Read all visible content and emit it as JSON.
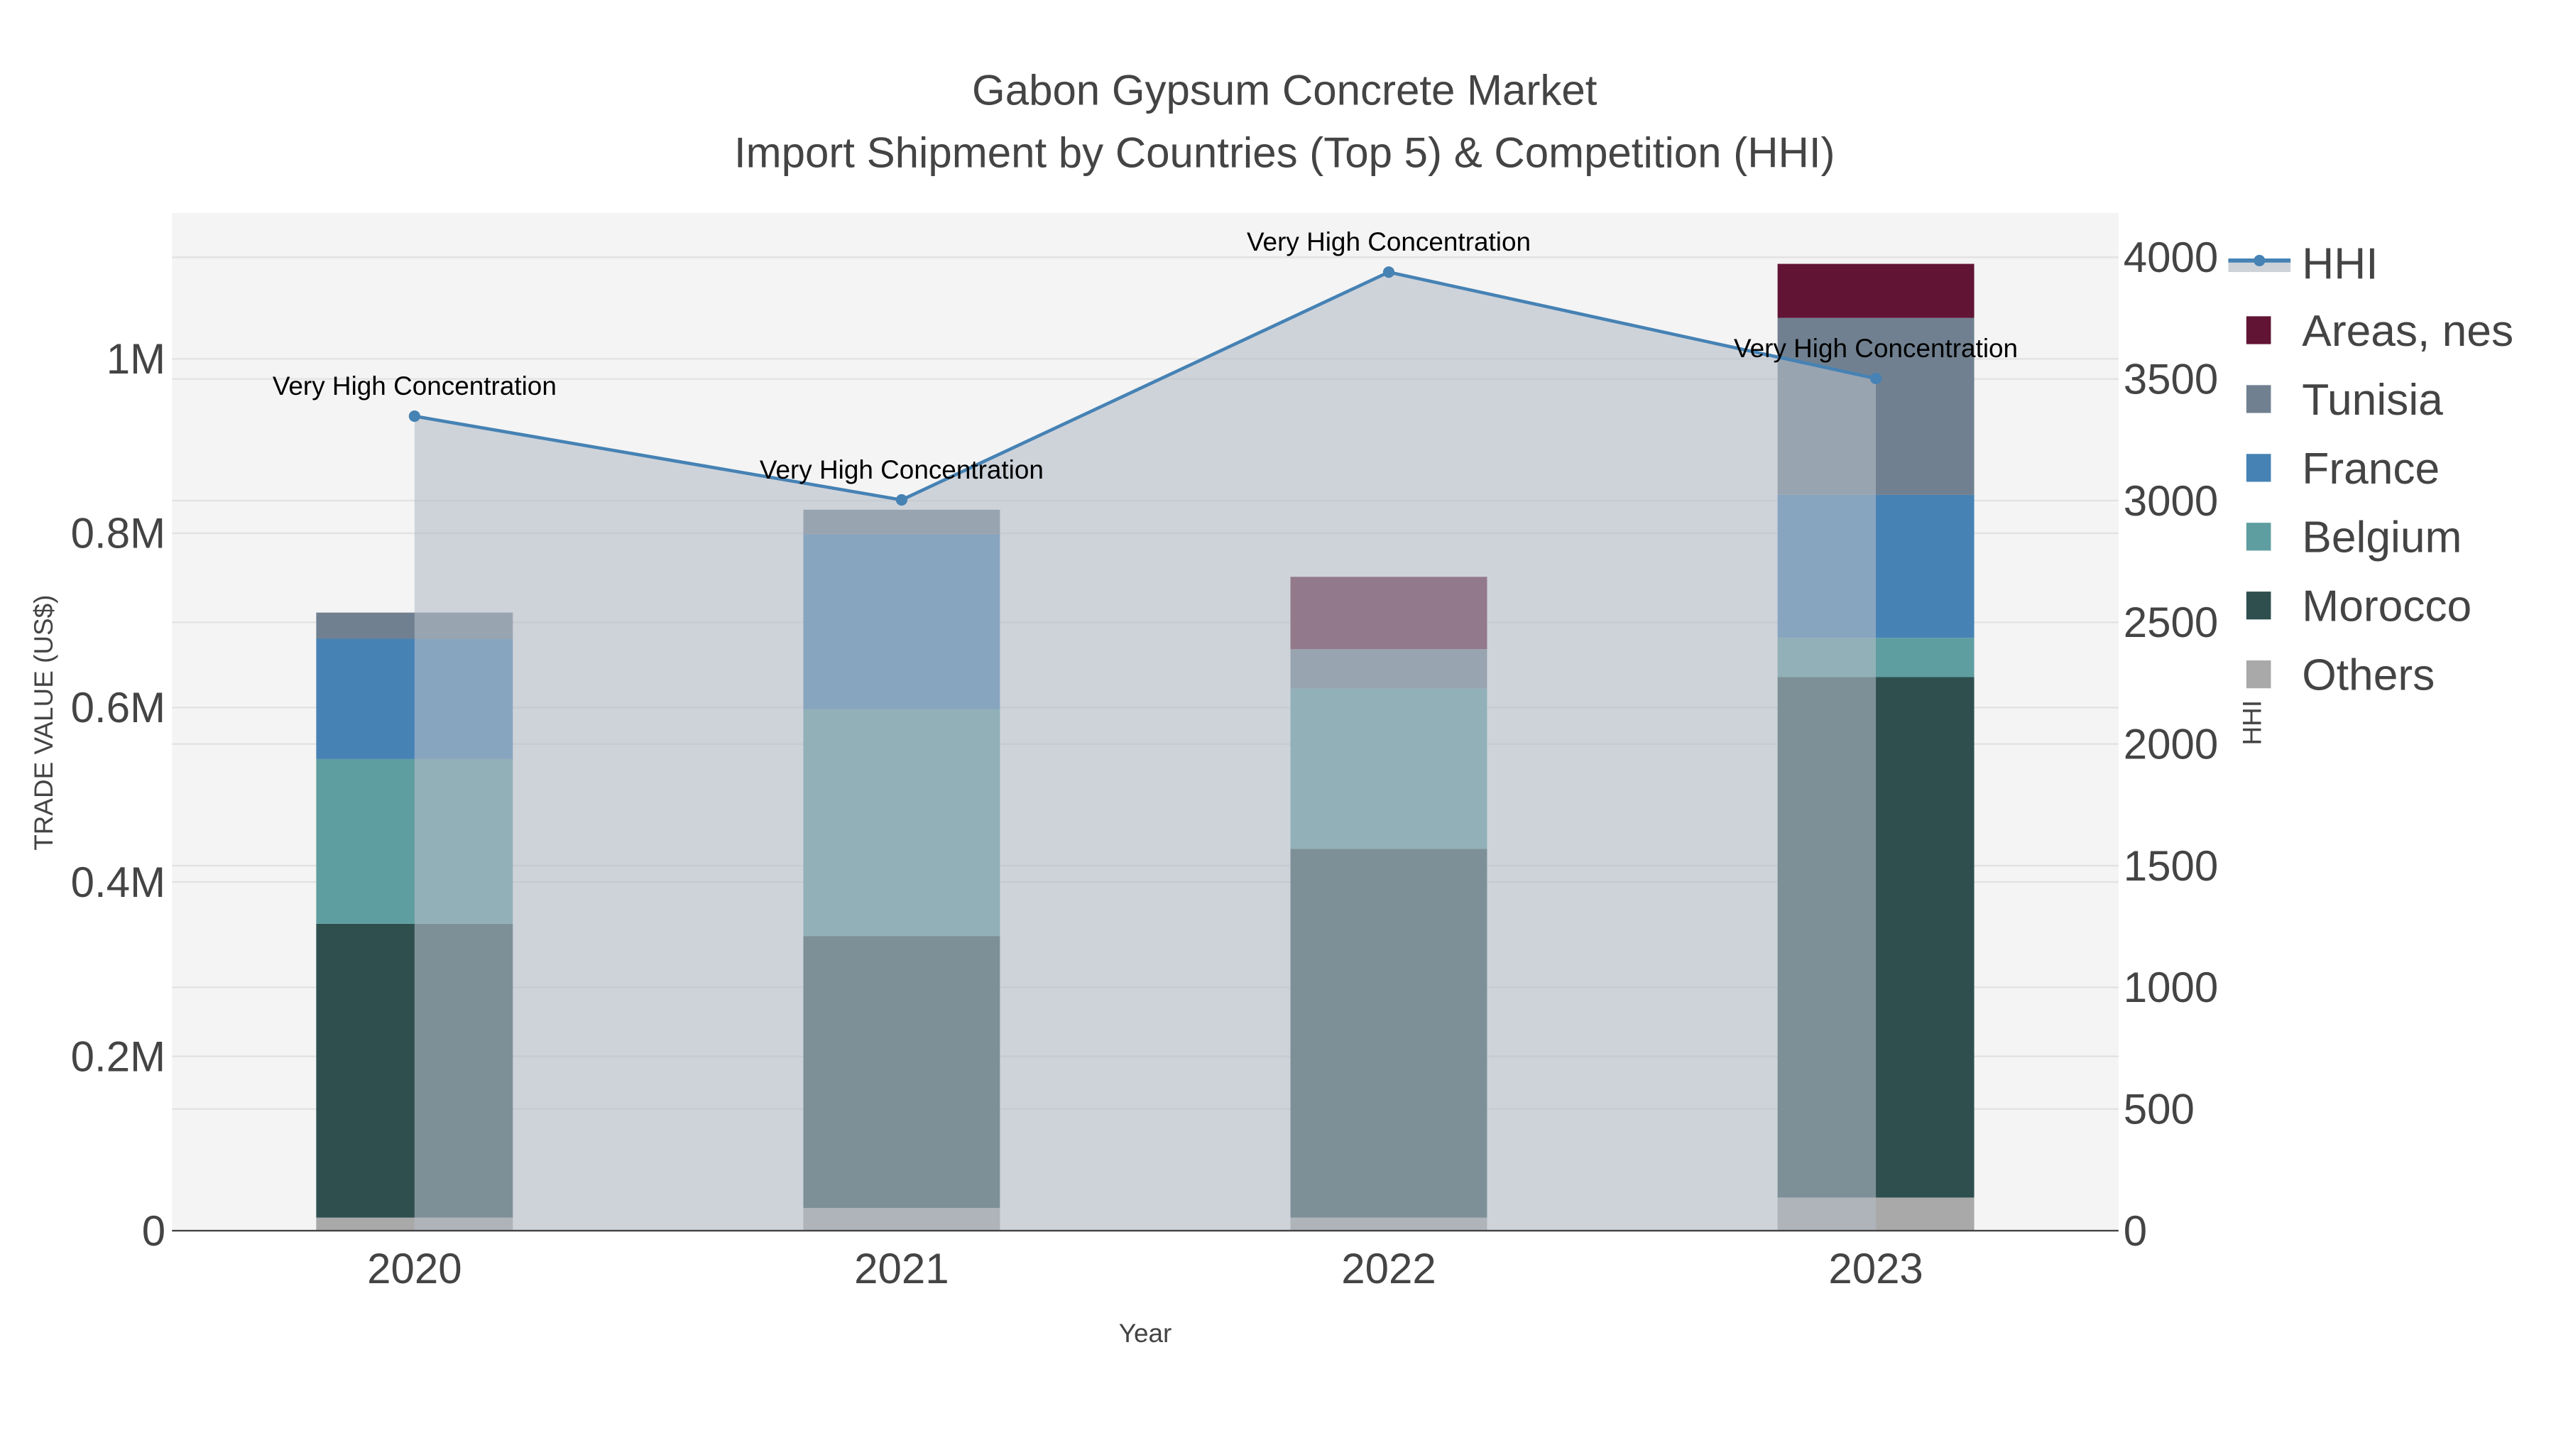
{
  "chart_data": {
    "type": "bar",
    "title": "Gabon Gypsum Concrete Market",
    "subtitle": "Import Shipment by Countries (Top 5) & Competition (HHI)",
    "xlabel": "Year",
    "ylabel": "TRADE VALUE (US$)",
    "y2label": "HHI",
    "categories": [
      "2020",
      "2021",
      "2022",
      "2023"
    ],
    "ylim": [
      0,
      1150000
    ],
    "y2lim": [
      0,
      4180
    ],
    "yticks": [
      0,
      200000,
      400000,
      600000,
      800000,
      1000000
    ],
    "ytick_labels": [
      "0",
      "0.2M",
      "0.4M",
      "0.6M",
      "0.8M",
      "1M"
    ],
    "y2ticks": [
      0,
      500,
      1000,
      1500,
      2000,
      2500,
      3000,
      3500,
      4000
    ],
    "y2tick_labels": [
      "0",
      "500",
      "1000",
      "1500",
      "2000",
      "2500",
      "3000",
      "3500",
      "4000"
    ],
    "grid": true,
    "legend_position": "right",
    "series": [
      {
        "name": "Others",
        "color": "#a9a9a9",
        "values": [
          15000,
          26000,
          15000,
          38000
        ]
      },
      {
        "name": "Morocco",
        "color": "#2f4f4f",
        "values": [
          337000,
          312000,
          423000,
          597000
        ]
      },
      {
        "name": "Belgium",
        "color": "#5f9ea0",
        "values": [
          189000,
          260000,
          184000,
          45000
        ]
      },
      {
        "name": "France",
        "color": "#4682b4",
        "values": [
          138000,
          201000,
          0,
          164000
        ]
      },
      {
        "name": "Tunisia",
        "color": "#708090",
        "values": [
          30000,
          28000,
          45000,
          203000
        ]
      },
      {
        "name": "Areas, nes",
        "color": "#611434",
        "values": [
          0,
          0,
          83000,
          62000
        ]
      }
    ],
    "hhi": {
      "name": "HHI",
      "color": "#4682b4",
      "values": [
        3347,
        3003,
        3939,
        3502
      ],
      "annotations": [
        "Very High Concentration",
        "Very High Concentration",
        "Very High Concentration",
        "Very High Concentration"
      ]
    }
  }
}
